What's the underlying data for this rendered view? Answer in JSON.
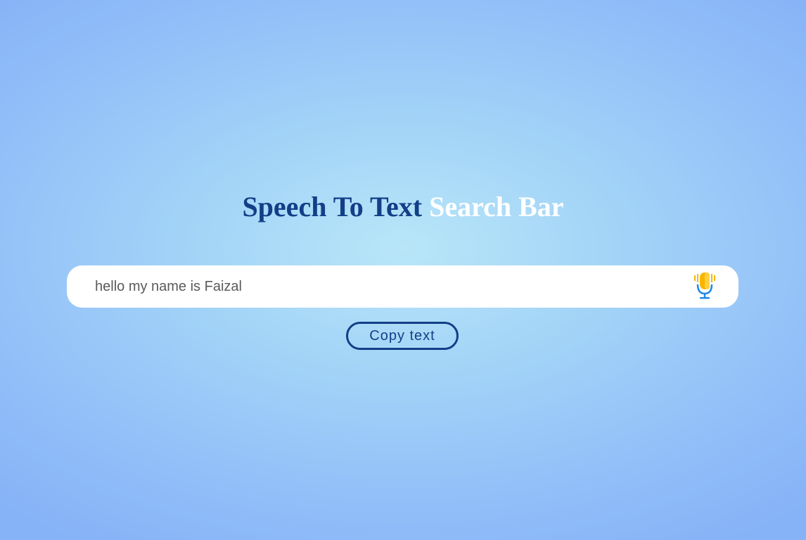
{
  "title": {
    "part1": "Speech To Text",
    "part2": "Search Bar"
  },
  "search": {
    "value": "hello my name is Faizal"
  },
  "mic": {
    "icon": "microphone-icon"
  },
  "copy_button": {
    "label": "Copy text"
  },
  "colors": {
    "accent_dark": "#123f87",
    "title_light": "#ffffff",
    "mic_body": "#f7b500",
    "mic_stand": "#1e88e5"
  }
}
